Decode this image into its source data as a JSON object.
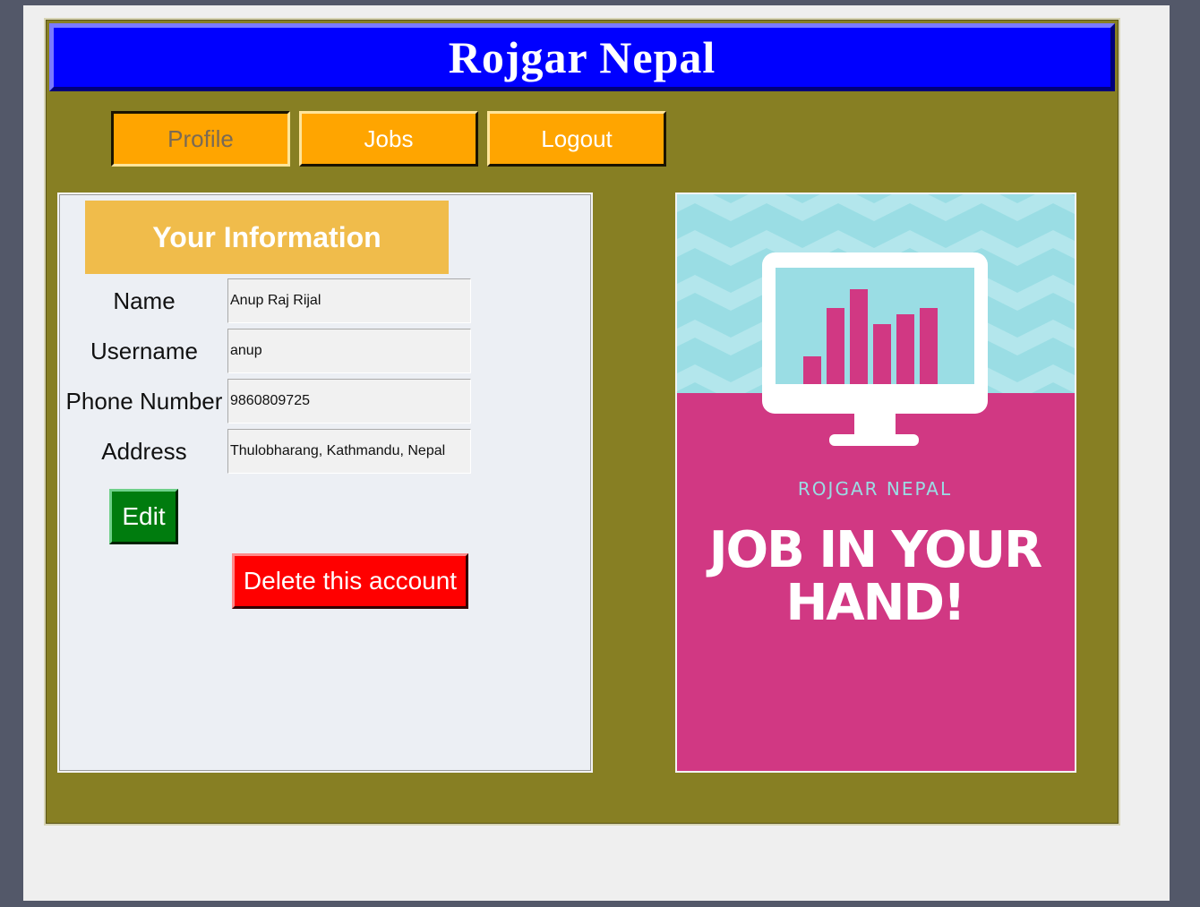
{
  "app": {
    "title": "Rojgar Nepal"
  },
  "nav": {
    "items": [
      {
        "label": "Profile",
        "active": true
      },
      {
        "label": "Jobs",
        "active": false
      },
      {
        "label": "Logout",
        "active": false
      }
    ]
  },
  "info": {
    "header": "Your Information",
    "fields": [
      {
        "label": "Name",
        "value": "Anup Raj Rijal"
      },
      {
        "label": "Username",
        "value": "anup"
      },
      {
        "label": "Phone Number",
        "value": "9860809725"
      },
      {
        "label": "Address",
        "value": "Thulobharang, Kathmandu, Nepal"
      }
    ],
    "edit_label": "Edit",
    "delete_label": "Delete this account"
  },
  "poster": {
    "brand": "ROJGAR NEPAL",
    "headline_line1": "JOB IN YOUR",
    "headline_line2": "HAND!",
    "icon": "computer-monitor-bar-chart-icon",
    "colors": {
      "top_background": "#9adde4",
      "bottom_background": "#d13883",
      "brand_text": "#9adde4",
      "headline_text": "#ffffff"
    }
  },
  "colors": {
    "title_bar": "#0000ff",
    "frame": "#877f23",
    "nav_button": "#ffa500",
    "info_header": "#f0bc4b",
    "edit_button": "#007c0e",
    "delete_button": "#ff0000"
  }
}
